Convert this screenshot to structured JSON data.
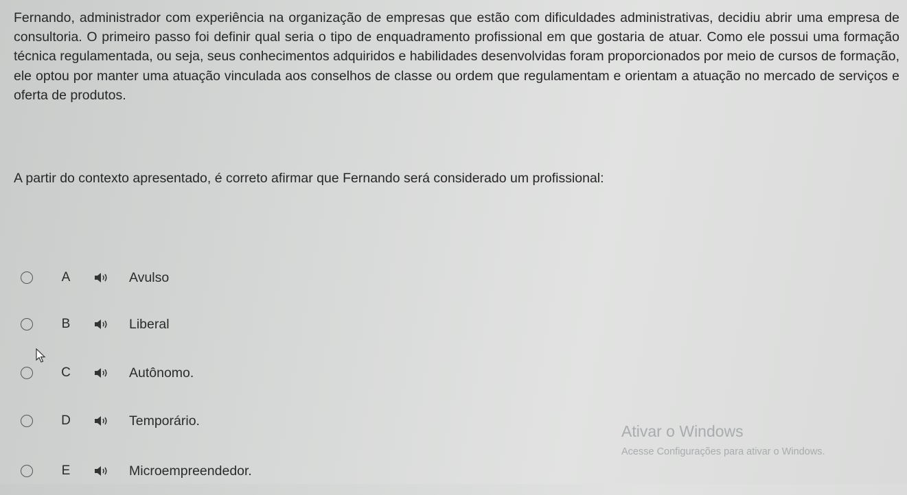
{
  "question": {
    "text": "Fernando, administrador com experiência na organização de empresas que estão com dificuldades administrativas, decidiu abrir uma empresa de consultoria. O primeiro passo foi definir qual seria o tipo de enquadramento profissional em que gostaria de atuar. Como ele possui uma formação técnica regulamentada, ou seja, seus conhecimentos adquiridos e habilidades desenvolvidas foram proporcionados por meio de cursos de formação, ele optou por manter uma atuação vinculada aos conselhos de classe ou ordem que regulamentam e orientam a atuação no mercado de serviços e oferta de produtos.",
    "prompt": "A partir do contexto apresentado, é correto afirmar que Fernando será considerado um profissional:"
  },
  "options": [
    {
      "letter": "A",
      "text": "Avulso",
      "icon": "speaker-icon"
    },
    {
      "letter": "B",
      "text": "Liberal",
      "icon": "speaker-icon"
    },
    {
      "letter": "C",
      "text": "Autônomo.",
      "icon": "speaker-icon"
    },
    {
      "letter": "D",
      "text": "Temporário.",
      "icon": "speaker-icon"
    },
    {
      "letter": "E",
      "text": "Microempreendedor.",
      "icon": "speaker-icon"
    }
  ],
  "watermark": {
    "title": "Ativar o Windows",
    "subtitle": "Acesse Configurações para ativar o Windows."
  }
}
